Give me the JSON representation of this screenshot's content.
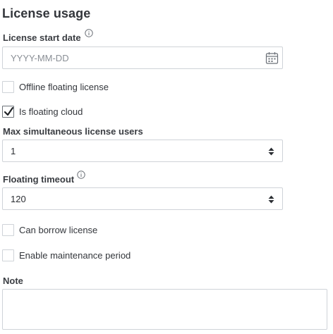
{
  "section": {
    "title": "License usage"
  },
  "license_start_date": {
    "label": "License start date",
    "placeholder": "YYYY-MM-DD",
    "value": "",
    "info_icon": "info-icon",
    "calendar_icon": "calendar-icon"
  },
  "offline_floating": {
    "label": "Offline floating license",
    "checked": false
  },
  "floating_cloud": {
    "label": "Is floating cloud",
    "checked": true
  },
  "max_users": {
    "label": "Max simultaneous license users",
    "value": "1",
    "spinner_icon": "spinner-icon"
  },
  "floating_timeout": {
    "label": "Floating timeout",
    "value": "120",
    "info_icon": "info-icon",
    "spinner_icon": "spinner-icon"
  },
  "can_borrow": {
    "label": "Can borrow license",
    "checked": false
  },
  "maintenance": {
    "label": "Enable maintenance period",
    "checked": false
  },
  "note": {
    "label": "Note",
    "value": ""
  },
  "colors": {
    "text": "#33363b",
    "border": "#cfd3d8",
    "placeholder": "#8a8f96"
  }
}
